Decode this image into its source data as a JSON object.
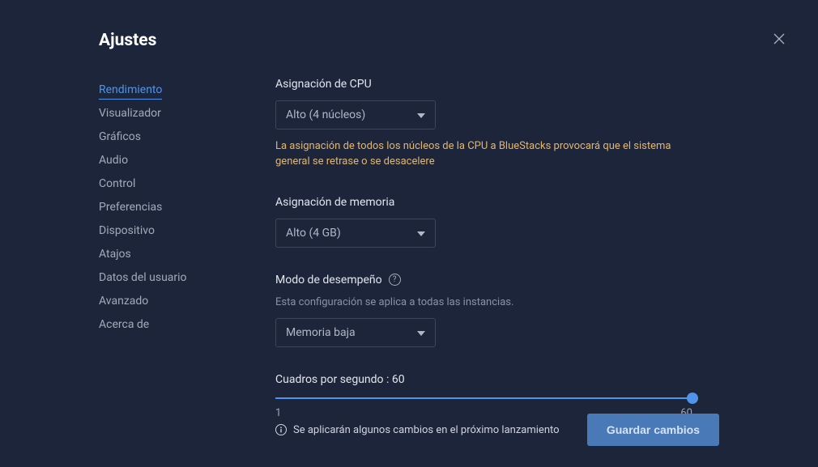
{
  "header": {
    "title": "Ajustes"
  },
  "sidebar": {
    "items": [
      {
        "label": "Rendimiento",
        "active": true
      },
      {
        "label": "Visualizador",
        "active": false
      },
      {
        "label": "Gráficos",
        "active": false
      },
      {
        "label": "Audio",
        "active": false
      },
      {
        "label": "Control",
        "active": false
      },
      {
        "label": "Preferencias",
        "active": false
      },
      {
        "label": "Dispositivo",
        "active": false
      },
      {
        "label": "Atajos",
        "active": false
      },
      {
        "label": "Datos del usuario",
        "active": false
      },
      {
        "label": "Avanzado",
        "active": false
      },
      {
        "label": "Acerca de",
        "active": false
      }
    ]
  },
  "main": {
    "cpu": {
      "label": "Asignación de CPU",
      "value": "Alto (4 núcleos)",
      "warning": "La asignación de todos los núcleos de la CPU a BlueStacks provocará que el sistema general se retrase o se desacelere"
    },
    "memory": {
      "label": "Asignación de memoria",
      "value": "Alto (4 GB)"
    },
    "performance": {
      "label": "Modo de desempeño",
      "sublabel": "Esta configuración se aplica a todas las instancias.",
      "value": "Memoria baja"
    },
    "fps": {
      "label_prefix": "Cuadros por segundo : ",
      "value": "60",
      "min": "1",
      "max": "60"
    }
  },
  "footer": {
    "note": "Se aplicarán algunos cambios en el próximo lanzamiento",
    "save": "Guardar cambios"
  }
}
